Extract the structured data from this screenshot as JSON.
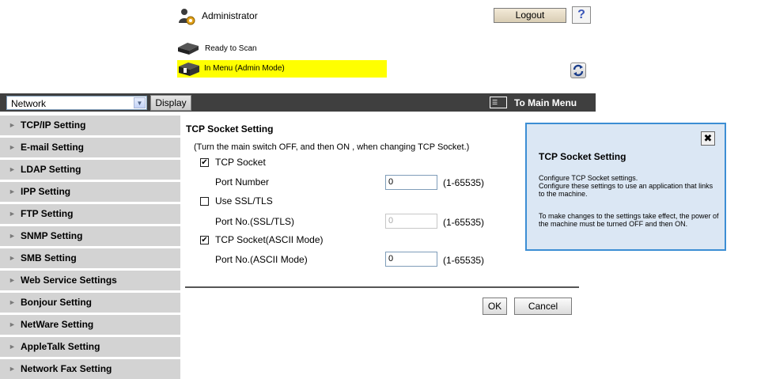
{
  "header": {
    "user_label": "Administrator",
    "logout_label": "Logout",
    "help_label": "?",
    "device_status": "Ready to Scan",
    "mode_status": "In Menu (Admin Mode)"
  },
  "top_bar": {
    "select_value": "Network",
    "display_label": "Display",
    "main_menu_label": "To Main Menu"
  },
  "sidebar": {
    "items": [
      {
        "label": "TCP/IP Setting"
      },
      {
        "label": "E-mail Setting"
      },
      {
        "label": "LDAP Setting"
      },
      {
        "label": "IPP Setting"
      },
      {
        "label": "FTP Setting"
      },
      {
        "label": "SNMP Setting"
      },
      {
        "label": "SMB Setting"
      },
      {
        "label": "Web Service Settings"
      },
      {
        "label": "Bonjour Setting"
      },
      {
        "label": "NetWare Setting"
      },
      {
        "label": "AppleTalk Setting"
      },
      {
        "label": "Network Fax Setting"
      }
    ]
  },
  "form": {
    "title": "TCP Socket Setting",
    "note": "(Turn the main switch OFF, and then ON , when changing TCP Socket.)",
    "tcp_socket": {
      "label": "TCP Socket",
      "checked": "✔"
    },
    "port_number": {
      "label": "Port Number",
      "value": "0",
      "range": "(1-65535)"
    },
    "ssl": {
      "label": "Use SSL/TLS",
      "checked": ""
    },
    "port_ssl": {
      "label": "Port No.(SSL/TLS)",
      "value": "0",
      "range": "(1-65535)"
    },
    "ascii": {
      "label": "TCP Socket(ASCII Mode)",
      "checked": "✔"
    },
    "port_ascii": {
      "label": "Port No.(ASCII Mode)",
      "value": "0",
      "range": "(1-65535)"
    },
    "ok_label": "OK",
    "cancel_label": "Cancel"
  },
  "help_panel": {
    "close_label": "✖",
    "title": "TCP Socket Setting",
    "p1": "Configure TCP Socket settings.\nConfigure these settings to use an application that links to the machine.",
    "p2": "To make changes to the settings take effect, the power of the machine must be turned OFF and then ON."
  },
  "colors": {
    "status_highlight": "#ffff00",
    "top_bar": "#3f3f3f",
    "sidebar": "#d3d3d3",
    "help_border": "#3c8ed4",
    "help_bg": "#dbe7f4"
  },
  "icons": [
    "admin-icon",
    "scanner-icon",
    "admin-mode-icon",
    "refresh-icon",
    "main-menu-icon",
    "close-icon"
  ]
}
